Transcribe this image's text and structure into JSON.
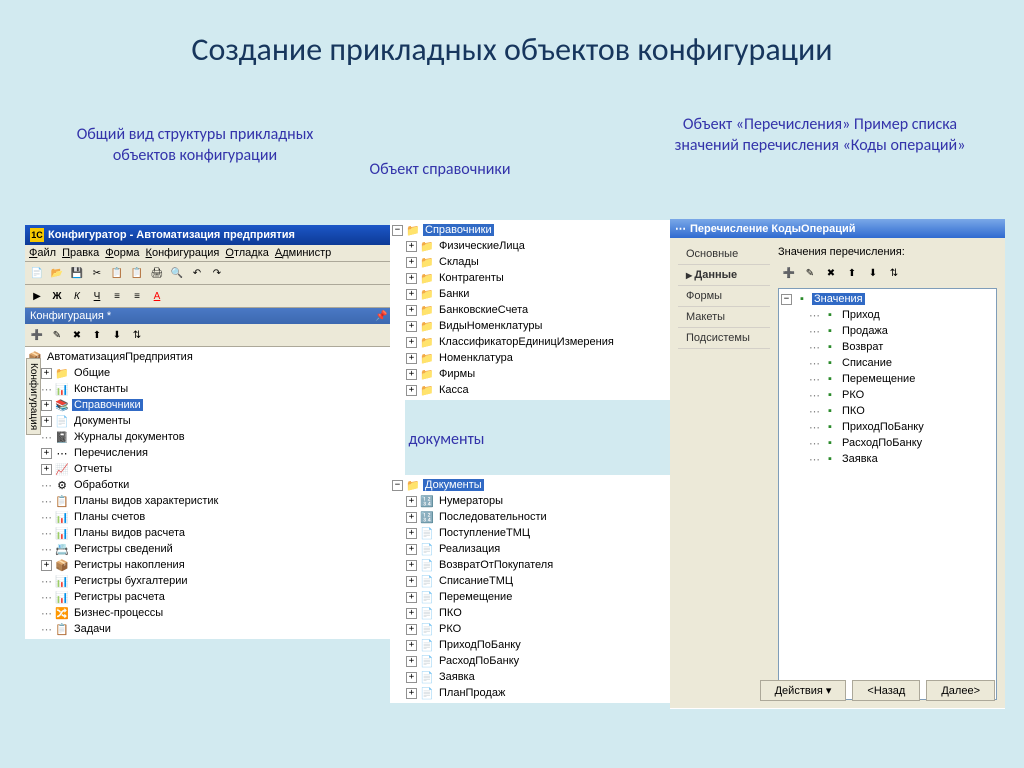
{
  "slide": {
    "title": "Создание прикладных объектов конфигурации",
    "caption1": "Общий вид структуры прикладных объектов конфигурации",
    "caption2": "Объект справочники",
    "caption3": "Объект «Перечисления» Пример списка значений перечисления «Коды операций»",
    "caption4": "Объект документы"
  },
  "cfg": {
    "title": "Конфигуратор - Автоматизация предприятия",
    "menu": [
      "Файл",
      "Правка",
      "Форма",
      "Конфигурация",
      "Отладка",
      "Администр"
    ],
    "paneTitle": "Конфигурация *",
    "sidetab": "Конфигурация",
    "root": "АвтоматизацияПредприятия",
    "items": [
      "Общие",
      "Константы",
      "Справочники",
      "Документы",
      "Журналы документов",
      "Перечисления",
      "Отчеты",
      "Обработки",
      "Планы видов характеристик",
      "Планы счетов",
      "Планы видов расчета",
      "Регистры сведений",
      "Регистры накопления",
      "Регистры бухгалтерии",
      "Регистры расчета",
      "Бизнес-процессы",
      "Задачи"
    ],
    "expanded": [
      true,
      false,
      true,
      true,
      false,
      true,
      true,
      false,
      false,
      false,
      false,
      false,
      true,
      false,
      false,
      false,
      false
    ],
    "selected": 2
  },
  "sprav": {
    "title": "Справочники",
    "items": [
      "ФизическиеЛица",
      "Склады",
      "Контрагенты",
      "Банки",
      "БанковскиеСчета",
      "ВидыНоменклатуры",
      "КлассификаторЕдиницИзмерения",
      "Номенклатура",
      "Фирмы",
      "Касса"
    ]
  },
  "docs": {
    "title": "Документы",
    "items": [
      "Нумераторы",
      "Последовательности",
      "ПоступлениеТМЦ",
      "Реализация",
      "ВозвратОтПокупателя",
      "СписаниеТМЦ",
      "Перемещение",
      "ПКО",
      "РКО",
      "ПриходПоБанку",
      "РасходПоБанку",
      "Заявка",
      "ПланПродаж"
    ]
  },
  "enum": {
    "title": "Перечисление КодыОпераций",
    "tabs": [
      "Основные",
      "Данные",
      "Формы",
      "Макеты",
      "Подсистемы"
    ],
    "activeTab": 1,
    "label": "Значения перечисления:",
    "root": "Значения",
    "values": [
      "Приход",
      "Продажа",
      "Возврат",
      "Списание",
      "Перемещение",
      "РКО",
      "ПКО",
      "ПриходПоБанку",
      "РасходПоБанку",
      "Заявка"
    ],
    "buttons": {
      "actions": "Действия",
      "back": "<Назад",
      "next": "Далее>"
    }
  }
}
